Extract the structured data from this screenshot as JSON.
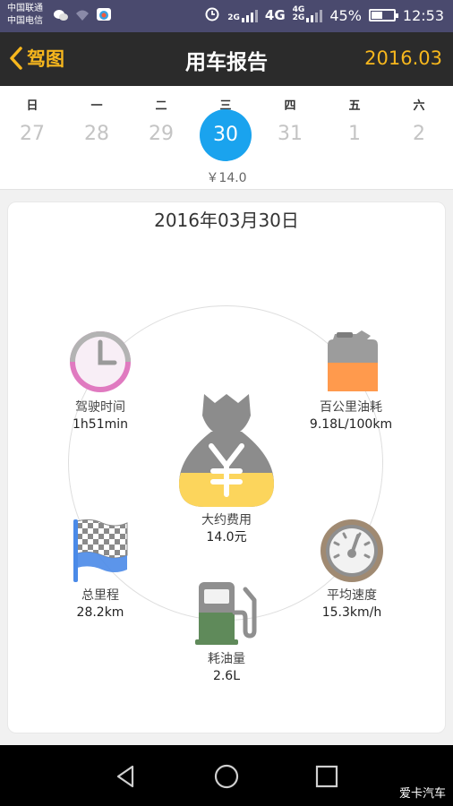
{
  "status_bar": {
    "carrier_1": "中国联通",
    "carrier_2": "中国电信",
    "network_1": "2G",
    "network_2": "4G",
    "network_3": "4G",
    "network_4": "2G",
    "battery": "45%",
    "battery_level": 0.45,
    "time": "12:53"
  },
  "header": {
    "back_label": "驾图",
    "title": "用车报告",
    "month": "2016.03"
  },
  "calendar": {
    "weekdays": [
      "日",
      "一",
      "二",
      "三",
      "四",
      "五",
      "六"
    ],
    "days": [
      "27",
      "28",
      "29",
      "30",
      "31",
      "1",
      "2"
    ],
    "selected_cost": "￥14.0"
  },
  "report": {
    "date": "2016年03月30日",
    "drive_time": {
      "label": "驾驶时间",
      "value": "1h51min"
    },
    "fuel_per_100km": {
      "label": "百公里油耗",
      "value": "9.18L/100km"
    },
    "cost": {
      "label": "大约费用",
      "value": "14.0元"
    },
    "mileage": {
      "label": "总里程",
      "value": "28.2km"
    },
    "avg_speed": {
      "label": "平均速度",
      "value": "15.3km/h"
    },
    "fuel_used": {
      "label": "耗油量",
      "value": "2.6L"
    }
  },
  "colors": {
    "accent": "#f7b71d",
    "selected_day": "#1aa3ee",
    "header_bg": "#2b2b2b",
    "clock_ring": "#e07ac0",
    "fuel_can_orange": "#ff9a4d",
    "money_yellow": "#fcd55c",
    "flag_blue": "#4a8ae8",
    "pump_green": "#5f8a5a",
    "gauge_brown": "#a08a72"
  },
  "watermark": "爱卡汽车"
}
